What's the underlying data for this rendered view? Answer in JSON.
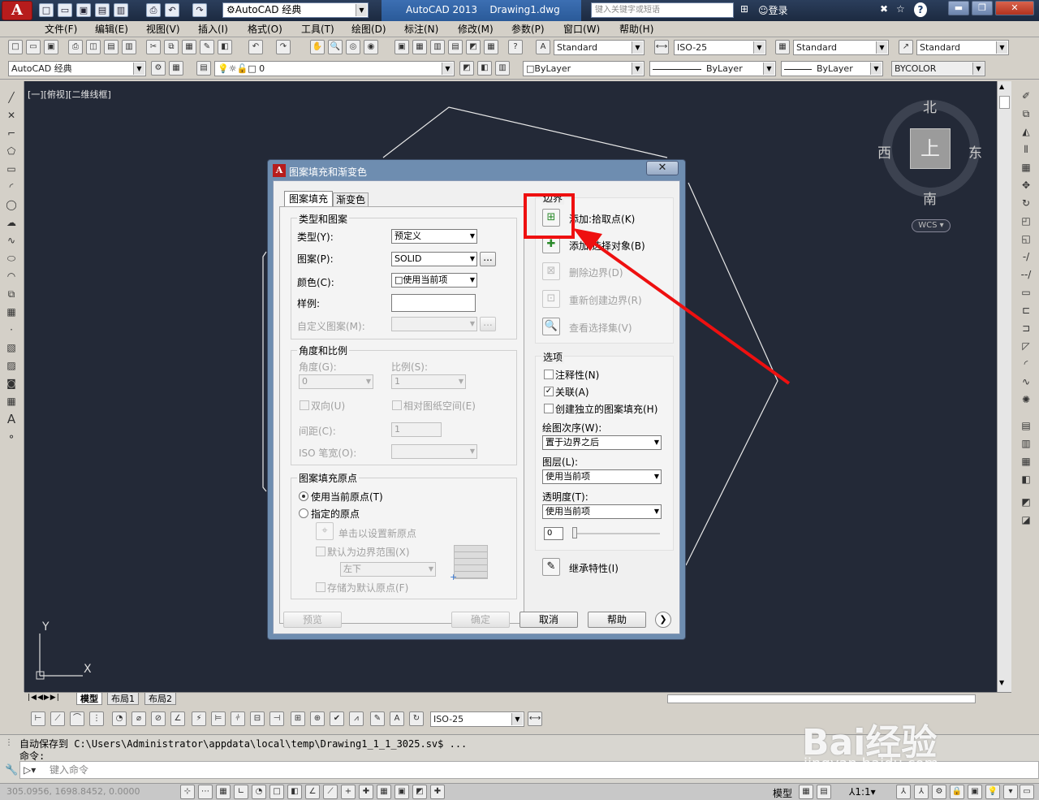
{
  "titlebar": {
    "app_logo": "A",
    "workspace": "AutoCAD 经典",
    "app_title": "AutoCAD 2013",
    "drawing": "Drawing1.dwg",
    "search_placeholder": "键入关键字或短语",
    "login": "登录",
    "help": "?"
  },
  "menu": [
    "文件(F)",
    "编辑(E)",
    "视图(V)",
    "插入(I)",
    "格式(O)",
    "工具(T)",
    "绘图(D)",
    "标注(N)",
    "修改(M)",
    "参数(P)",
    "窗口(W)",
    "帮助(H)"
  ],
  "styles": {
    "text_style": "Standard",
    "dim_style": "ISO-25",
    "table_style": "Standard",
    "mleader_style": "Standard"
  },
  "layers": {
    "workspace": "AutoCAD 经典",
    "layer": "0",
    "color": "ByLayer",
    "linetype": "ByLayer",
    "lineweight": "ByLayer",
    "plotstyle": "BYCOLOR"
  },
  "canvas": {
    "view_label": "[一][俯视][二维线框]",
    "compass": {
      "north": "北",
      "south": "南",
      "east": "东",
      "west": "西",
      "top": "上"
    },
    "wcs": "WCS",
    "ucs_y": "Y",
    "ucs_x": "X"
  },
  "layout_tabs": [
    "模型",
    "布局1",
    "布局2"
  ],
  "dim_style_box": "ISO-25",
  "command": {
    "line1": "自动保存到 C:\\Users\\Administrator\\appdata\\local\\temp\\Drawing1_1_1_3025.sv$ ...",
    "line2": "命令:",
    "placeholder": "键入命令"
  },
  "status": {
    "coords": "305.0956, 1698.8452, 0.0000",
    "model": "模型",
    "scale": "1:1"
  },
  "watermark": {
    "main": "Bai经验",
    "sub": "jingyan.baidu.com"
  },
  "dialog": {
    "title": "图案填充和渐变色",
    "close": "✕",
    "tabs": [
      "图案填充",
      "渐变色"
    ],
    "type_group": {
      "title": "类型和图案",
      "type_label": "类型(Y):",
      "type_value": "预定义",
      "pattern_label": "图案(P):",
      "pattern_value": "SOLID",
      "color_label": "颜色(C):",
      "color_value": "使用当前项",
      "sample_label": "样例:",
      "custom_label": "自定义图案(M):"
    },
    "angle_group": {
      "title": "角度和比例",
      "angle_label": "角度(G):",
      "angle_value": "0",
      "scale_label": "比例(S):",
      "scale_value": "1",
      "double_label": "双向(U)",
      "relative_label": "相对图纸空间(E)",
      "spacing_label": "间距(C):",
      "spacing_value": "1",
      "iso_label": "ISO 笔宽(O):"
    },
    "origin_group": {
      "title": "图案填充原点",
      "use_current": "使用当前原点(T)",
      "specified": "指定的原点",
      "click_set": "单击以设置新原点",
      "default_extent": "默认为边界范围(X)",
      "position": "左下",
      "store_default": "存储为默认原点(F)"
    },
    "boundary": {
      "title": "边界",
      "add_pick": "添加:拾取点(K)",
      "add_select": "添加:选择对象(B)",
      "remove": "删除边界(D)",
      "recreate": "重新创建边界(R)",
      "view_sel": "查看选择集(V)"
    },
    "options": {
      "title": "选项",
      "annotative": "注释性(N)",
      "associative": "关联(A)",
      "separate": "创建独立的图案填充(H)",
      "draw_order_label": "绘图次序(W):",
      "draw_order": "置于边界之后",
      "layer_label": "图层(L):",
      "layer": "使用当前项",
      "transparency_label": "透明度(T):",
      "transparency": "使用当前项",
      "transparency_value": "0"
    },
    "inherit": "继承特性(I)",
    "buttons": {
      "preview": "预览",
      "ok": "确定",
      "cancel": "取消",
      "help": "帮助"
    }
  }
}
